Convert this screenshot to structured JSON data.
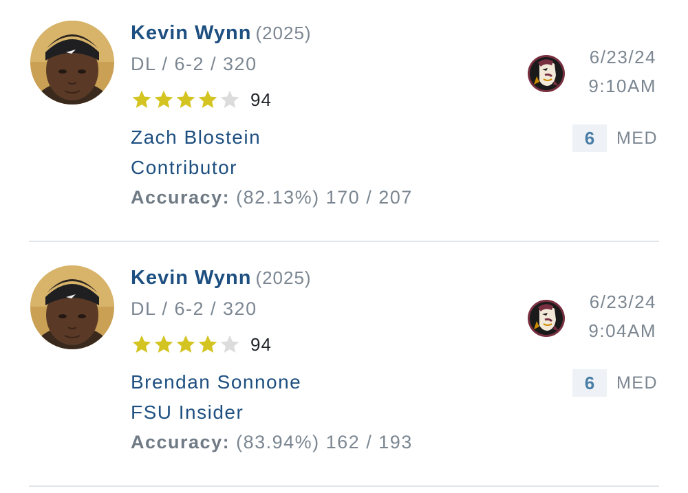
{
  "predictions": [
    {
      "player": {
        "name": "Kevin Wynn",
        "class_year": "(2025)",
        "meta": "DL / 6-2 / 320",
        "stars": 4,
        "max_stars": 5,
        "rating": "94",
        "avatar_icon": "player-headshot"
      },
      "expert": {
        "name": "Zach Blostein",
        "title": "Contributor",
        "accuracy_label": "Accuracy:",
        "accuracy_value": "(82.13%) 170 / 207"
      },
      "team_logo_icon": "fsu-seminole-logo",
      "date": "6/23/24",
      "time": "9:10AM",
      "confidence": {
        "number": "6",
        "label": "MED"
      }
    },
    {
      "player": {
        "name": "Kevin Wynn",
        "class_year": "(2025)",
        "meta": "DL / 6-2 / 320",
        "stars": 4,
        "max_stars": 5,
        "rating": "94",
        "avatar_icon": "player-headshot"
      },
      "expert": {
        "name": "Brendan Sonnone",
        "title": "FSU Insider",
        "accuracy_label": "Accuracy:",
        "accuracy_value": "(83.94%) 162 / 193"
      },
      "team_logo_icon": "fsu-seminole-logo",
      "date": "6/23/24",
      "time": "9:04AM",
      "confidence": {
        "number": "6",
        "label": "MED"
      }
    }
  ],
  "colors": {
    "name_blue": "#1d4f80",
    "meta_gray": "#7b8691",
    "star_gold": "#d4c422",
    "star_empty": "#dcdcdc",
    "confidence_bg": "#eef2f6",
    "confidence_text": "#4a7ea6",
    "divider": "#e2e5e8",
    "fsu_garnet": "#782f40"
  }
}
